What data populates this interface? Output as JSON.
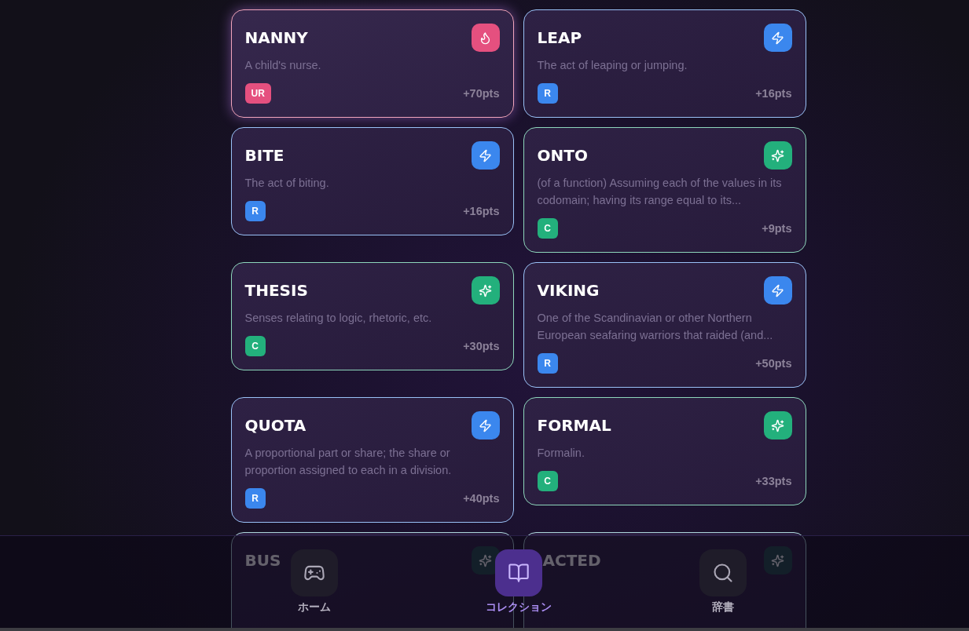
{
  "cards": [
    {
      "title": "NANNY",
      "definition": "A child's nurse.",
      "rarity": "UR",
      "points": "+70pts",
      "kind": "flame",
      "color": "#e5507f"
    },
    {
      "title": "LEAP",
      "definition": "The act of leaping or jumping.",
      "rarity": "R",
      "points": "+16pts",
      "kind": "bolt",
      "color": "#3b87ee"
    },
    {
      "title": "BITE",
      "definition": "The act of biting.",
      "rarity": "R",
      "points": "+16pts",
      "kind": "bolt",
      "color": "#3b87ee"
    },
    {
      "title": "ONTO",
      "definition": "(of a function) Assuming each of the values in its codomain; having its range equal to its...",
      "rarity": "C",
      "points": "+9pts",
      "kind": "sparkle",
      "color": "#23b07c"
    },
    {
      "title": "THESIS",
      "definition": "Senses relating to logic, rhetoric, etc.",
      "rarity": "C",
      "points": "+30pts",
      "kind": "sparkle",
      "color": "#23b07c"
    },
    {
      "title": "VIKING",
      "definition": "One of the Scandinavian or other Northern European seafaring warriors that raided (and...",
      "rarity": "R",
      "points": "+50pts",
      "kind": "bolt",
      "color": "#3b87ee"
    },
    {
      "title": "QUOTA",
      "definition": "A proportional part or share; the share or proportion assigned to each in a division.",
      "rarity": "R",
      "points": "+40pts",
      "kind": "bolt",
      "color": "#3b87ee"
    },
    {
      "title": "FORMAL",
      "definition": "Formalin.",
      "rarity": "C",
      "points": "+33pts",
      "kind": "sparkle",
      "color": "#23b07c"
    },
    {
      "title": "BUS",
      "kind": "sparkle"
    },
    {
      "title": "ACTED",
      "kind": "sparkle"
    }
  ],
  "nav": {
    "items": [
      {
        "label": "ホーム",
        "kind": "gamepad",
        "selected": false
      },
      {
        "label": "コレクション",
        "kind": "book",
        "selected": true
      },
      {
        "label": "辞書",
        "kind": "search",
        "selected": false
      }
    ]
  }
}
